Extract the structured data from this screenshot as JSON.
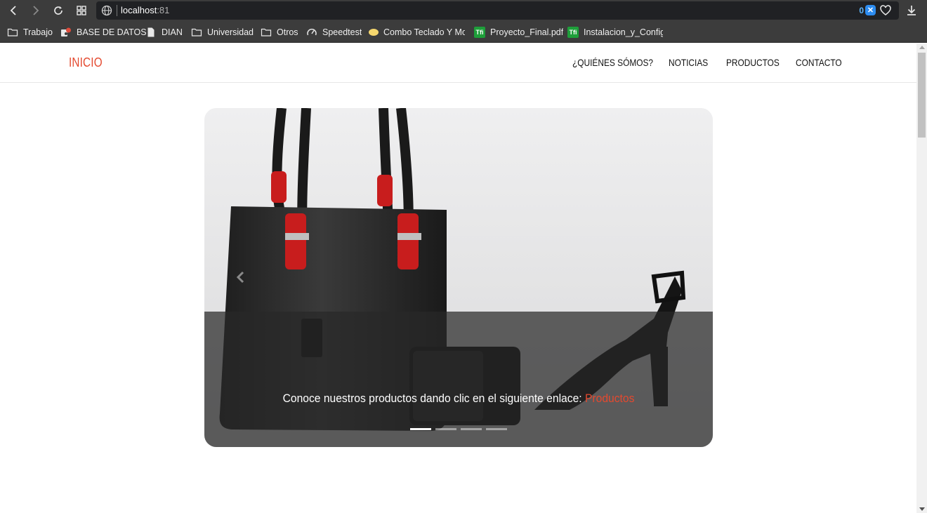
{
  "browser": {
    "url_host": "localhost",
    "url_port": ":81",
    "extension_count": "0",
    "bookmarks": [
      {
        "label": "Trabajo",
        "icon": "folder-icon"
      },
      {
        "label": "BASE DE DATOS",
        "icon": "database-app-icon"
      },
      {
        "label": "DIAN",
        "icon": "document-icon"
      },
      {
        "label": "Universidad",
        "icon": "folder-icon"
      },
      {
        "label": "Otros",
        "icon": "folder-icon"
      },
      {
        "label": "Speedtest",
        "icon": "speedometer-icon"
      },
      {
        "label": "Combo Teclado Y Mo",
        "icon": "combo-store-icon"
      },
      {
        "label": "Proyecto_Final.pdf",
        "icon": "tfi-icon"
      },
      {
        "label": "Instalacion_y_Configu",
        "icon": "tfi-icon"
      }
    ]
  },
  "site": {
    "brand": "INICIO",
    "nav": [
      "¿QUIÉNES SÓMOS?",
      "NOTICIAS",
      "PRODUCTOS",
      "CONTACTO"
    ],
    "accent_color": "#e4492f"
  },
  "carousel": {
    "caption": "Conoce nuestros productos dando clic en el siguiente enlace: ",
    "caption_link": "Productos",
    "slide_count": 4,
    "active_slide": 1
  }
}
